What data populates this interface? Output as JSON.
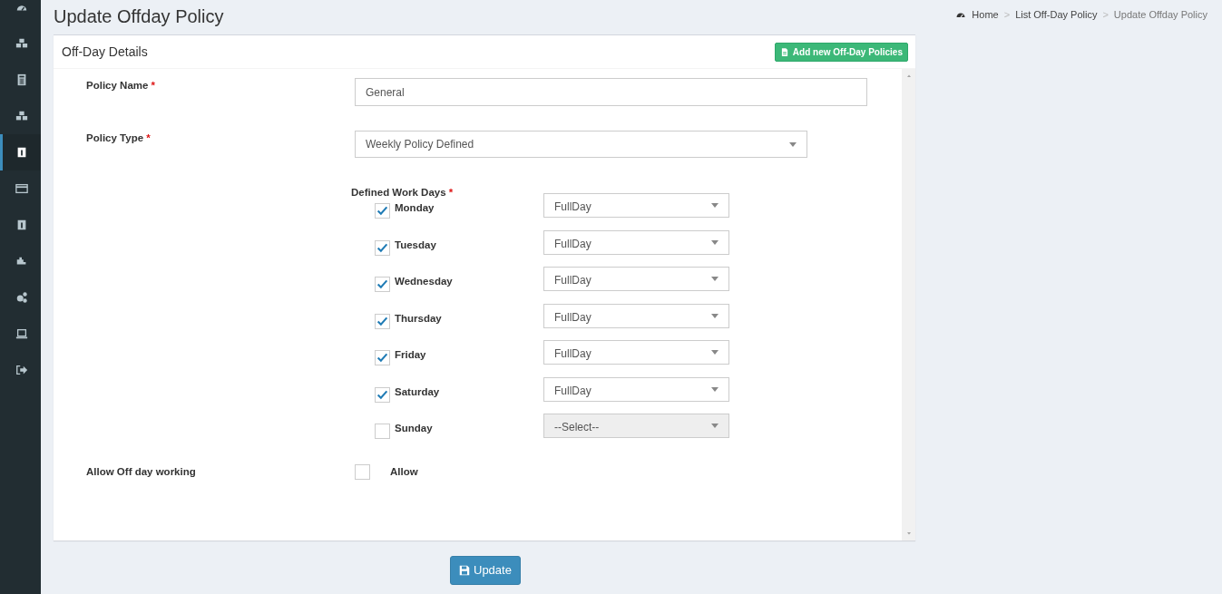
{
  "sidebar": {
    "items": [
      {
        "selected": false
      },
      {
        "selected": false
      },
      {
        "selected": false
      },
      {
        "selected": false
      },
      {
        "selected": true
      },
      {
        "selected": false
      },
      {
        "selected": false
      },
      {
        "selected": false
      },
      {
        "selected": false
      },
      {
        "selected": false
      },
      {
        "selected": false
      }
    ]
  },
  "page_title": "Update Offday Policy",
  "breadcrumb": [
    {
      "label": "Home",
      "current": false
    },
    {
      "label": "List Off-Day Policy",
      "current": false
    },
    {
      "label": "Update Offday Policy",
      "current": true
    }
  ],
  "breadcrumb_separator": ">",
  "card": {
    "title": "Off-Day Details",
    "add_button": "Add new Off-Day Policies"
  },
  "policy_name": {
    "label": "Policy Name",
    "required_mark": "*",
    "value": "General"
  },
  "policy_type": {
    "label": "Policy Type",
    "required_mark": "*",
    "value": "Weekly Policy Defined"
  },
  "work_days": {
    "label": "Defined Work Days",
    "required_mark": "*",
    "days": [
      {
        "name": "Monday",
        "checked": true,
        "value": "FullDay",
        "disabled": false
      },
      {
        "name": "Tuesday",
        "checked": true,
        "value": "FullDay",
        "disabled": false
      },
      {
        "name": "Wednesday",
        "checked": true,
        "value": "FullDay",
        "disabled": false
      },
      {
        "name": "Thursday",
        "checked": true,
        "value": "FullDay",
        "disabled": false
      },
      {
        "name": "Friday",
        "checked": true,
        "value": "FullDay",
        "disabled": false
      },
      {
        "name": "Saturday",
        "checked": true,
        "value": "FullDay",
        "disabled": false
      },
      {
        "name": "Sunday",
        "checked": false,
        "value": "--Select--",
        "disabled": true
      }
    ]
  },
  "allow_off_day": {
    "label": "Allow Off day working",
    "option": "Allow",
    "checked": false
  },
  "update_button": "Update"
}
